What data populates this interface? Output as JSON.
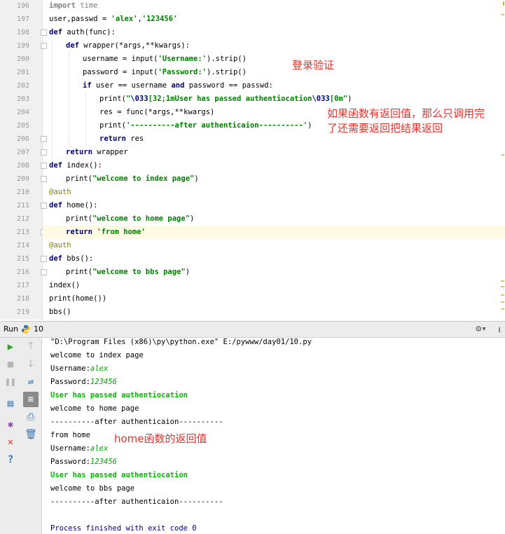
{
  "editor": {
    "line_numbers": [
      "196",
      "197",
      "198",
      "199",
      "200",
      "201",
      "202",
      "203",
      "204",
      "205",
      "206",
      "207",
      "208",
      "209",
      "210",
      "211",
      "212",
      "213",
      "214",
      "215",
      "216",
      "217",
      "218",
      "219"
    ],
    "lines": {
      "l196": {
        "kw": "import",
        "rest": " time"
      },
      "l197": {
        "a": "user,passwd = ",
        "s1": "'alex'",
        "b": ",",
        "s2": "'123456'"
      },
      "l198": {
        "kw": "def",
        "rest": " auth(func):"
      },
      "l199": {
        "kw": "def",
        "rest": " wrapper(*args,**kwargs):"
      },
      "l200": {
        "a": "username = input(",
        "s": "'Username:'",
        "b": ").strip()"
      },
      "l201": {
        "a": "password = input(",
        "s": "'Password:'",
        "b": ").strip()"
      },
      "l202": {
        "kw1": "if",
        "a": " user == username ",
        "kw2": "and",
        "b": " password == passwd:"
      },
      "l203": {
        "a": "print(",
        "s1": "\"",
        "esc1": "\\033",
        "s2": "[32;1mUser has passed authentiocation",
        "esc2": "\\033",
        "s3": "[0m\"",
        "b": ")"
      },
      "l204": {
        "a": "res = func(*args,**kwargs)"
      },
      "l205": {
        "a": "print(",
        "s": "'----------after authenticaion----------'",
        "b": ")"
      },
      "l206": {
        "kw": "return",
        "rest": " res"
      },
      "l207": {
        "kw": "return",
        "rest": " wrapper"
      },
      "l208": {
        "kw": "def",
        "rest": " index():"
      },
      "l209": {
        "a": "print(",
        "s": "\"welcome to index page\"",
        "b": ")"
      },
      "l210": {
        "dec": "@auth"
      },
      "l211": {
        "kw": "def",
        "rest": " home():"
      },
      "l212": {
        "a": "print(",
        "s": "\"welcome to home page\"",
        "b": ")"
      },
      "l213": {
        "kw": "return",
        "sp": " ",
        "s": "'from home'"
      },
      "l214": {
        "dec": "@auth"
      },
      "l215": {
        "kw": "def",
        "rest": " bbs():"
      },
      "l216": {
        "a": "print(",
        "s": "\"welcome to bbs page\"",
        "b": ")"
      },
      "l217": {
        "a": "index()"
      },
      "l218": {
        "a": "print(home())"
      },
      "l219": {
        "a": "bbs()"
      }
    },
    "annotations": {
      "login": "登录验证",
      "return_note_1": "如果函数有返回值，那么只调用完",
      "return_note_2": "了还需要返回把结果返回"
    }
  },
  "run_panel": {
    "label": "Run",
    "tab_name": "10",
    "output": {
      "cmd": "\"D:\\Program Files (x86)\\py\\python.exe\" E:/pywww/day01/10.py",
      "o1": "welcome to index page",
      "o2_label": "Username:",
      "o2_val": "alex",
      "o3_label": "Password:",
      "o3_val": "123456",
      "o4": "User has passed authentiocation",
      "o5": "welcome to home page",
      "o6": "----------after authenticaion----------",
      "o7": "from home",
      "o8_label": "Username:",
      "o8_val": "alex",
      "o9_label": "Password:",
      "o9_val": "123456",
      "o10": "User has passed authentiocation",
      "o11": "welcome to bbs page",
      "o12": "----------after authenticaion----------",
      "exit": "Process finished with exit code 0"
    },
    "annotation": "home函数的返回值"
  },
  "colors": {
    "keyword": "#000080",
    "string": "#008000",
    "annotation": "#e8302a",
    "highlight_row": "#fffae3"
  }
}
